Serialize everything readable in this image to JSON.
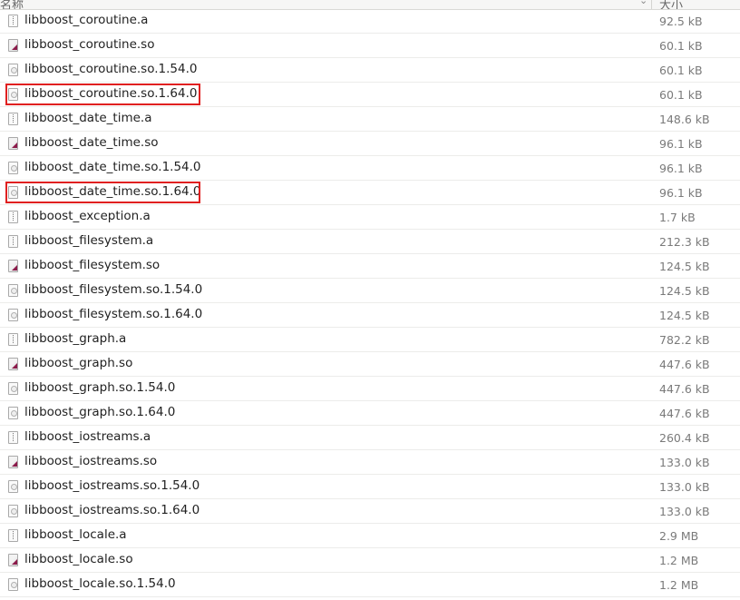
{
  "header": {
    "name_label": "名称",
    "size_label": "大小",
    "sort_icon": "chevron-down-icon"
  },
  "highlight_color": "#e02020",
  "files": [
    {
      "name": "libboost_coroutine.a",
      "size": "92.5 kB",
      "icon": "archive-file-icon"
    },
    {
      "name": "libboost_coroutine.so",
      "size": "60.1 kB",
      "icon": "symlink-file-icon"
    },
    {
      "name": "libboost_coroutine.so.1.54.0",
      "size": "60.1 kB",
      "icon": "shared-library-icon"
    },
    {
      "name": "libboost_coroutine.so.1.64.0",
      "size": "60.1 kB",
      "icon": "shared-library-icon",
      "highlighted": true
    },
    {
      "name": "libboost_date_time.a",
      "size": "148.6 kB",
      "icon": "archive-file-icon"
    },
    {
      "name": "libboost_date_time.so",
      "size": "96.1 kB",
      "icon": "symlink-file-icon"
    },
    {
      "name": "libboost_date_time.so.1.54.0",
      "size": "96.1 kB",
      "icon": "shared-library-icon"
    },
    {
      "name": "libboost_date_time.so.1.64.0",
      "size": "96.1 kB",
      "icon": "shared-library-icon",
      "highlighted": true
    },
    {
      "name": "libboost_exception.a",
      "size": "1.7 kB",
      "icon": "archive-file-icon"
    },
    {
      "name": "libboost_filesystem.a",
      "size": "212.3 kB",
      "icon": "archive-file-icon"
    },
    {
      "name": "libboost_filesystem.so",
      "size": "124.5 kB",
      "icon": "symlink-file-icon"
    },
    {
      "name": "libboost_filesystem.so.1.54.0",
      "size": "124.5 kB",
      "icon": "shared-library-icon"
    },
    {
      "name": "libboost_filesystem.so.1.64.0",
      "size": "124.5 kB",
      "icon": "shared-library-icon"
    },
    {
      "name": "libboost_graph.a",
      "size": "782.2 kB",
      "icon": "archive-file-icon"
    },
    {
      "name": "libboost_graph.so",
      "size": "447.6 kB",
      "icon": "symlink-file-icon"
    },
    {
      "name": "libboost_graph.so.1.54.0",
      "size": "447.6 kB",
      "icon": "shared-library-icon"
    },
    {
      "name": "libboost_graph.so.1.64.0",
      "size": "447.6 kB",
      "icon": "shared-library-icon"
    },
    {
      "name": "libboost_iostreams.a",
      "size": "260.4 kB",
      "icon": "archive-file-icon"
    },
    {
      "name": "libboost_iostreams.so",
      "size": "133.0 kB",
      "icon": "symlink-file-icon"
    },
    {
      "name": "libboost_iostreams.so.1.54.0",
      "size": "133.0 kB",
      "icon": "shared-library-icon"
    },
    {
      "name": "libboost_iostreams.so.1.64.0",
      "size": "133.0 kB",
      "icon": "shared-library-icon"
    },
    {
      "name": "libboost_locale.a",
      "size": "2.9 MB",
      "icon": "archive-file-icon"
    },
    {
      "name": "libboost_locale.so",
      "size": "1.2 MB",
      "icon": "symlink-file-icon"
    },
    {
      "name": "libboost_locale.so.1.54.0",
      "size": "1.2 MB",
      "icon": "shared-library-icon"
    }
  ]
}
